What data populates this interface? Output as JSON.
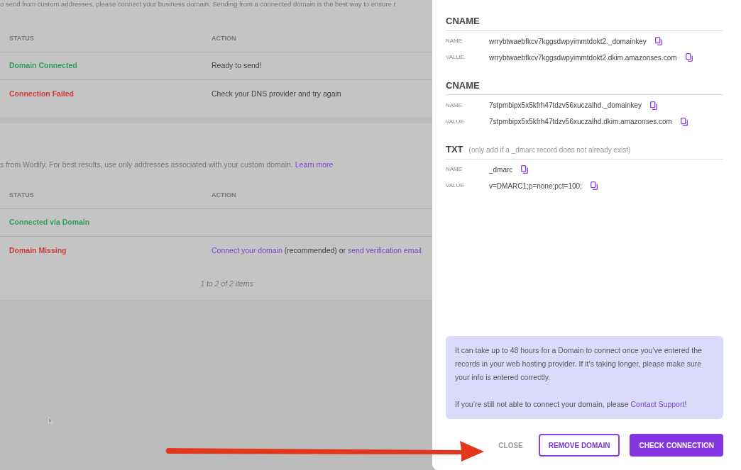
{
  "intro_text": "o send from custom addresses, please connect your business domain. Sending from a connected domain is the best way to ensure r",
  "table_1": {
    "columns": [
      "STATUS",
      "ACTION"
    ],
    "rows": [
      {
        "status": "Domain Connected",
        "color": "#2f9e5b",
        "action": [
          {
            "kind": "text",
            "text": "Ready to send!"
          }
        ]
      },
      {
        "status": "Connection Failed",
        "color": "#d13b3b",
        "action": [
          {
            "kind": "text",
            "text": "Check your DNS provider and try again"
          }
        ]
      }
    ]
  },
  "section_2": {
    "description": "s from Wodify. For best results, use only addresses associated with your custom domain.",
    "link": "Learn more"
  },
  "table_2": {
    "columns": [
      "STATUS",
      "ACTION"
    ],
    "rows": [
      {
        "status": "Connected via Domain",
        "color": "#2f9e5b",
        "action": []
      },
      {
        "status": "Domain Missing",
        "color": "#d13b3b",
        "action": [
          {
            "kind": "link",
            "text": "Connect your domain"
          },
          {
            "kind": "text",
            "text": "(recommended) or"
          },
          {
            "kind": "link",
            "text": "send verification email"
          }
        ]
      }
    ]
  },
  "pagination": "1 to 2 of 2 items",
  "drawer": {
    "records": [
      {
        "type": "CNAME",
        "fields": [
          {
            "label": "NAME",
            "value": "wrrybtwaebfkcv7kggsdwpyimmtdokt2._domainkey"
          },
          {
            "label": "VALUE",
            "value": "wrrybtwaebfkcv7kggsdwpyimmtdokt2.dkim.amazonses.com"
          }
        ]
      },
      {
        "type": "CNAME",
        "fields": [
          {
            "label": "NAME",
            "value": "7stpmbipx5x5kfrh47tdzv56xuczalhd._domainkey"
          },
          {
            "label": "VALUE",
            "value": "7stpmbipx5x5kfrh47tdzv56xuczalhd.dkim.amazonses.com"
          }
        ]
      },
      {
        "type": "TXT",
        "note": "(only add if a _dmarc record does not already exist)",
        "fields": [
          {
            "label": "NAME",
            "value": "_dmarc"
          },
          {
            "label": "VALUE",
            "value": "v=DMARC1;p=none;pct=100;"
          }
        ]
      }
    ],
    "info": {
      "paragraph_1": "It can take up to 48 hours for a Domain to connect once you’ve entered the records in your web hosting provider. If it’s taking longer, please make sure your info is entered correctly.",
      "paragraph_2": "If you’re still not able to connect your domain, please",
      "link": "Contact Support",
      "suffix": "!"
    },
    "buttons": [
      {
        "label": "CLOSE",
        "kind": "text"
      },
      {
        "label": "REMOVE DOMAIN",
        "kind": "outline"
      },
      {
        "label": "CHECK CONNECTION",
        "kind": "filled"
      }
    ]
  }
}
